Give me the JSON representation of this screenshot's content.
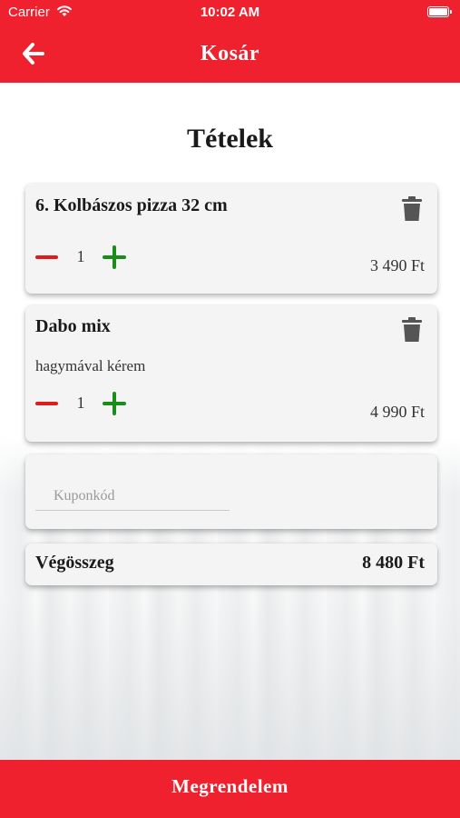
{
  "status_bar": {
    "carrier": "Carrier",
    "time": "10:02 AM"
  },
  "header": {
    "title": "Kosár",
    "back_icon": "arrow-left-icon"
  },
  "section": {
    "title": "Tételek"
  },
  "cart": {
    "items": [
      {
        "name": "6. Kolbászos pizza 32 cm",
        "note": "",
        "quantity": "1",
        "price": "3 490 Ft"
      },
      {
        "name": "Dabo mix",
        "note": "hagymával kérem",
        "quantity": "1",
        "price": "4 990 Ft"
      }
    ]
  },
  "coupon": {
    "placeholder": "Kuponkód",
    "value": ""
  },
  "total": {
    "label": "Végösszeg",
    "value": "8 480 Ft"
  },
  "footer": {
    "order_button": "Megrendelem"
  },
  "colors": {
    "brand_red": "#f0212e",
    "minus_red": "#e01b1b",
    "plus_green": "#1a8c1a",
    "trash_gray": "#555555"
  }
}
